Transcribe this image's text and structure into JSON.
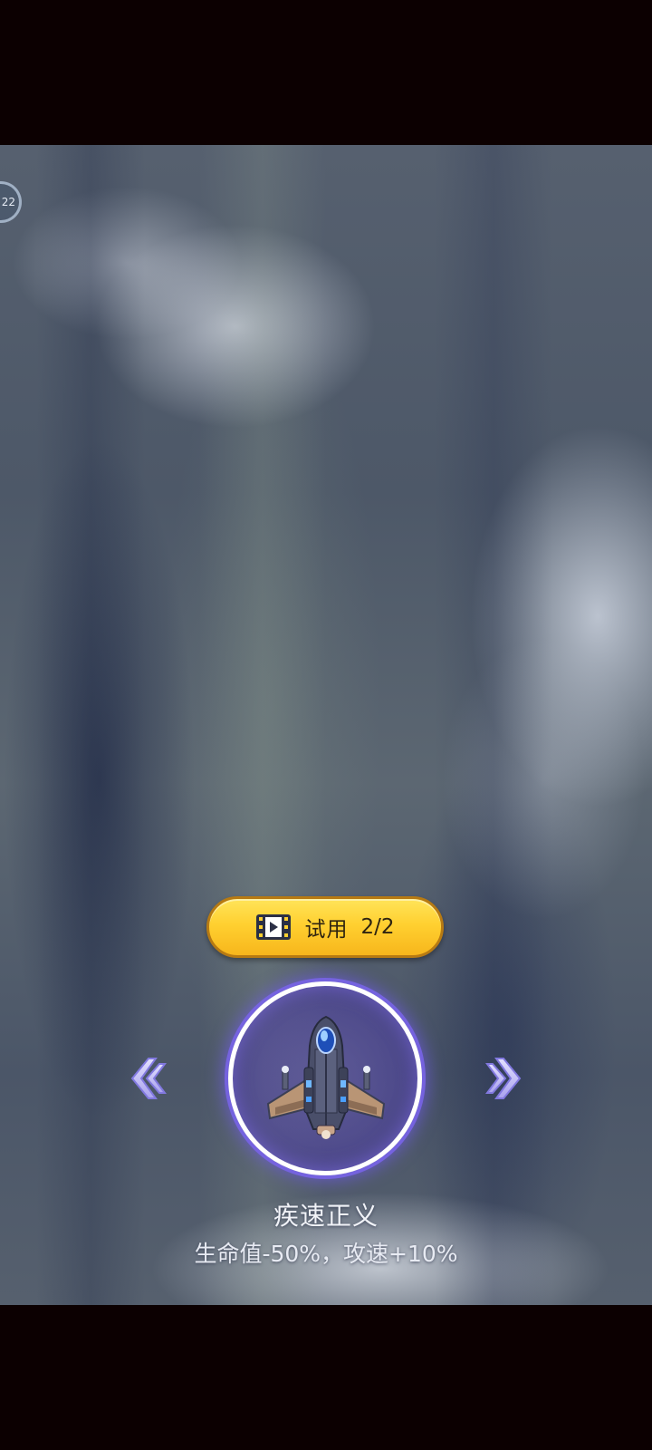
{
  "hud": {
    "timer_badge_text": "22"
  },
  "trial_button": {
    "icon": "video-film-icon",
    "label": "试用",
    "count": "2/2"
  },
  "carousel": {
    "prev_icon": "double-chevron-left-icon",
    "next_icon": "double-chevron-right-icon",
    "selected_plane": {
      "icon": "fighter-jet-icon",
      "name": "疾速正义",
      "stats": "生命值-50%，攻速+10%"
    }
  },
  "colors": {
    "button_yellow": "#ffd030",
    "ring_glow": "#6e5ae6",
    "arrow_lavender": "#c9c4f7",
    "letterbox": "#0c0001"
  }
}
